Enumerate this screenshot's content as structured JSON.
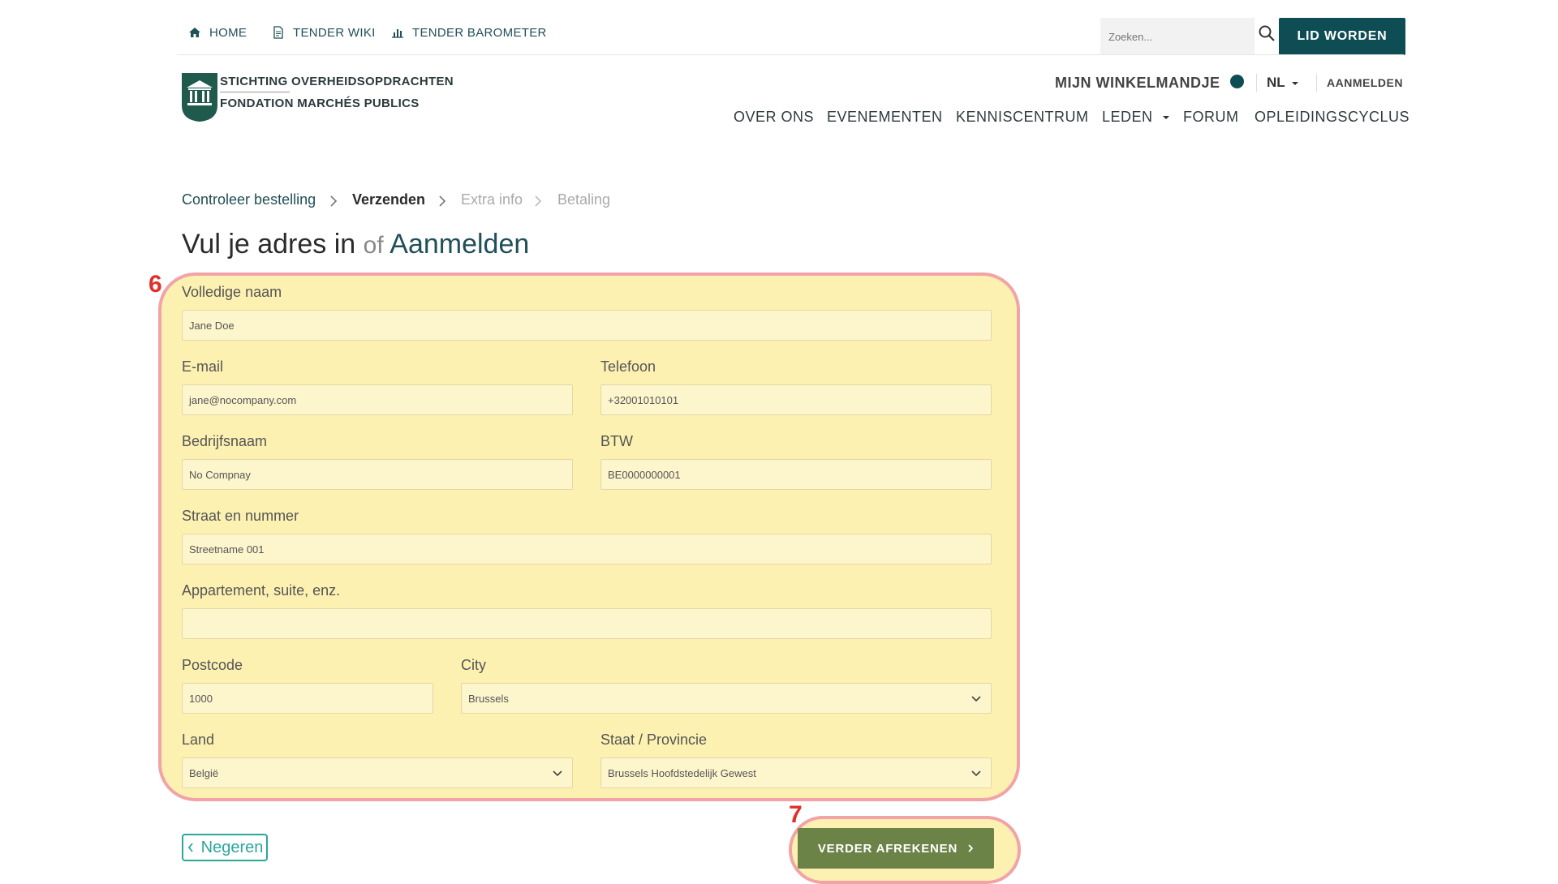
{
  "topbar": {
    "home": "HOME",
    "wiki": "TENDER WIKI",
    "barometer": "TENDER BAROMETER",
    "search_placeholder": "Zoeken...",
    "join_button": "LID WORDEN"
  },
  "header": {
    "logo_line1": "STICHTING OVERHEIDSOPDRACHTEN",
    "logo_line2": "FONDATION MARCHÉS PUBLICS",
    "cart": "MIJN WINKELMANDJE",
    "language": "NL",
    "login": "AANMELDEN",
    "nav": {
      "over_ons": "OVER ONS",
      "evenementen": "EVENEMENTEN",
      "kenniscentrum": "KENNISCENTRUM",
      "leden": "LEDEN",
      "forum": "FORUM",
      "opleidingscyclus": "OPLEIDINGSCYCLUS"
    }
  },
  "breadcrumb": {
    "step1": "Controleer bestelling",
    "step2": "Verzenden",
    "step3": "Extra info",
    "step4": "Betaling"
  },
  "page": {
    "title": "Vul je adres in",
    "or": "of",
    "login_link": "Aanmelden"
  },
  "annotations": {
    "form_number": "6",
    "button_number": "7"
  },
  "form": {
    "name_label": "Volledige naam",
    "name_value": "Jane Doe",
    "email_label": "E-mail",
    "email_value": "jane@nocompany.com",
    "phone_label": "Telefoon",
    "phone_value": "+32001010101",
    "company_label": "Bedrijfsnaam",
    "company_value": "No Compnay",
    "vat_label": "BTW",
    "vat_value": "BE0000000001",
    "street_label": "Straat en nummer",
    "street_value": "Streetname 001",
    "apartment_label": "Appartement, suite, enz.",
    "apartment_value": "",
    "postcode_label": "Postcode",
    "postcode_value": "1000",
    "city_label": "City",
    "city_value": "Brussels",
    "country_label": "Land",
    "country_value": "België",
    "state_label": "Staat / Provincie",
    "state_value": "Brussels Hoofdstedelijk Gewest"
  },
  "actions": {
    "back": "Negeren",
    "continue": "VERDER AFREKENEN"
  },
  "colors": {
    "brand_teal": "#0f4d55",
    "continue_green": "#6b8347",
    "highlight_fill": "#fdf1b2",
    "highlight_border": "#f2a3a7",
    "annotation_red": "#e0302c",
    "back_teal": "#2aa79b"
  }
}
